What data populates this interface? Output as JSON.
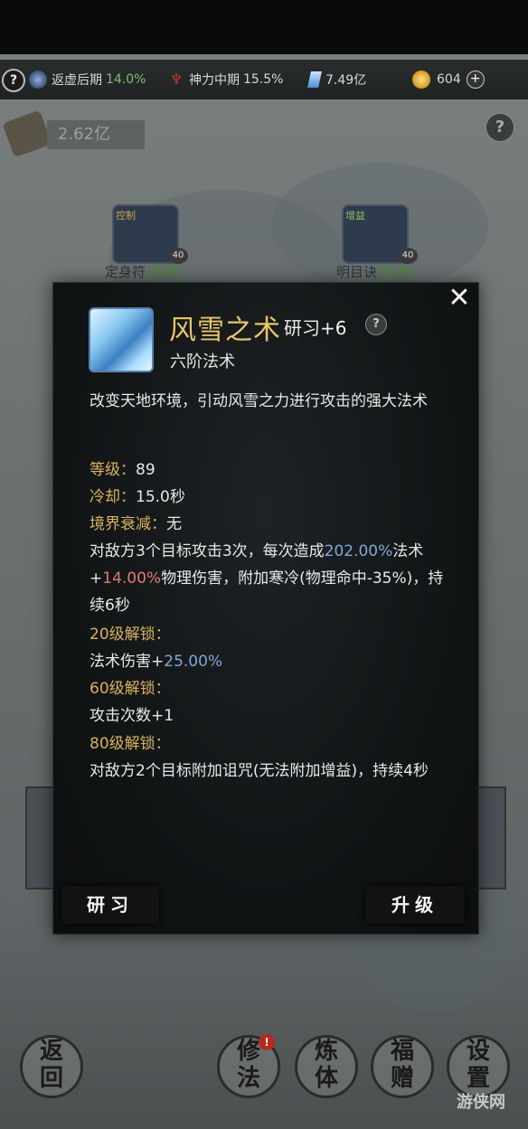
{
  "status_bar": {
    "help_icon": "question-icon",
    "realm": {
      "icon": "yin-yang-icon",
      "label": "返虚后期",
      "percent": "14.0%"
    },
    "divine": {
      "icon": "divine-power-icon",
      "label": "神力中期",
      "percent": "15.5%"
    },
    "crystal": {
      "icon": "crystal-icon",
      "value": "7.49亿"
    },
    "coin": {
      "icon": "coin-icon",
      "value": "604"
    },
    "add_icon": "plus-icon"
  },
  "resource": {
    "icon": "scroll-icon",
    "value": "2.62亿"
  },
  "background_skills": [
    {
      "name": "定身符",
      "tag": "(圆满)",
      "level": "40",
      "badge": "控制"
    },
    {
      "name": "明目诀",
      "tag": "(圆满)",
      "level": "40",
      "badge": "增益"
    }
  ],
  "popup": {
    "title": "风雪之术",
    "research": "研习+6",
    "tier": "六阶法术",
    "description": "改变天地环境，引动风雪之力进行攻击的强大法术",
    "level_label": "等级：",
    "level_value": "89",
    "cooldown_label": "冷却：",
    "cooldown_value": "15.0秒",
    "decay_label": "境界衰减：",
    "decay_value": "无",
    "effect_1": "对敌方3个目标攻击3次，每次造成",
    "effect_pct1": "202.00%",
    "effect_2": "法术+",
    "effect_pct2": "14.00%",
    "effect_3": "物理伤害，附加寒冷(物理命中-35%)，持续6秒",
    "unlock20_label": "20级解锁：",
    "unlock20_text": "法术伤害+",
    "unlock20_pct": "25.00%",
    "unlock60_label": "60级解锁：",
    "unlock60_text": "攻击次数+1",
    "unlock80_label": "80级解锁：",
    "unlock80_text": "对敌方2个目标附加诅咒(无法附加增益)，持续4秒",
    "research_button": "研习",
    "upgrade_button": "升级",
    "close_icon": "close-icon"
  },
  "bottom_nav": {
    "back": [
      "返",
      "回"
    ],
    "cultivate": [
      "修",
      "法"
    ],
    "body": [
      "炼",
      "体"
    ],
    "gift": [
      "福",
      "赠"
    ],
    "settings": [
      "设",
      "置"
    ],
    "badge": "!"
  },
  "watermark": "游侠网"
}
